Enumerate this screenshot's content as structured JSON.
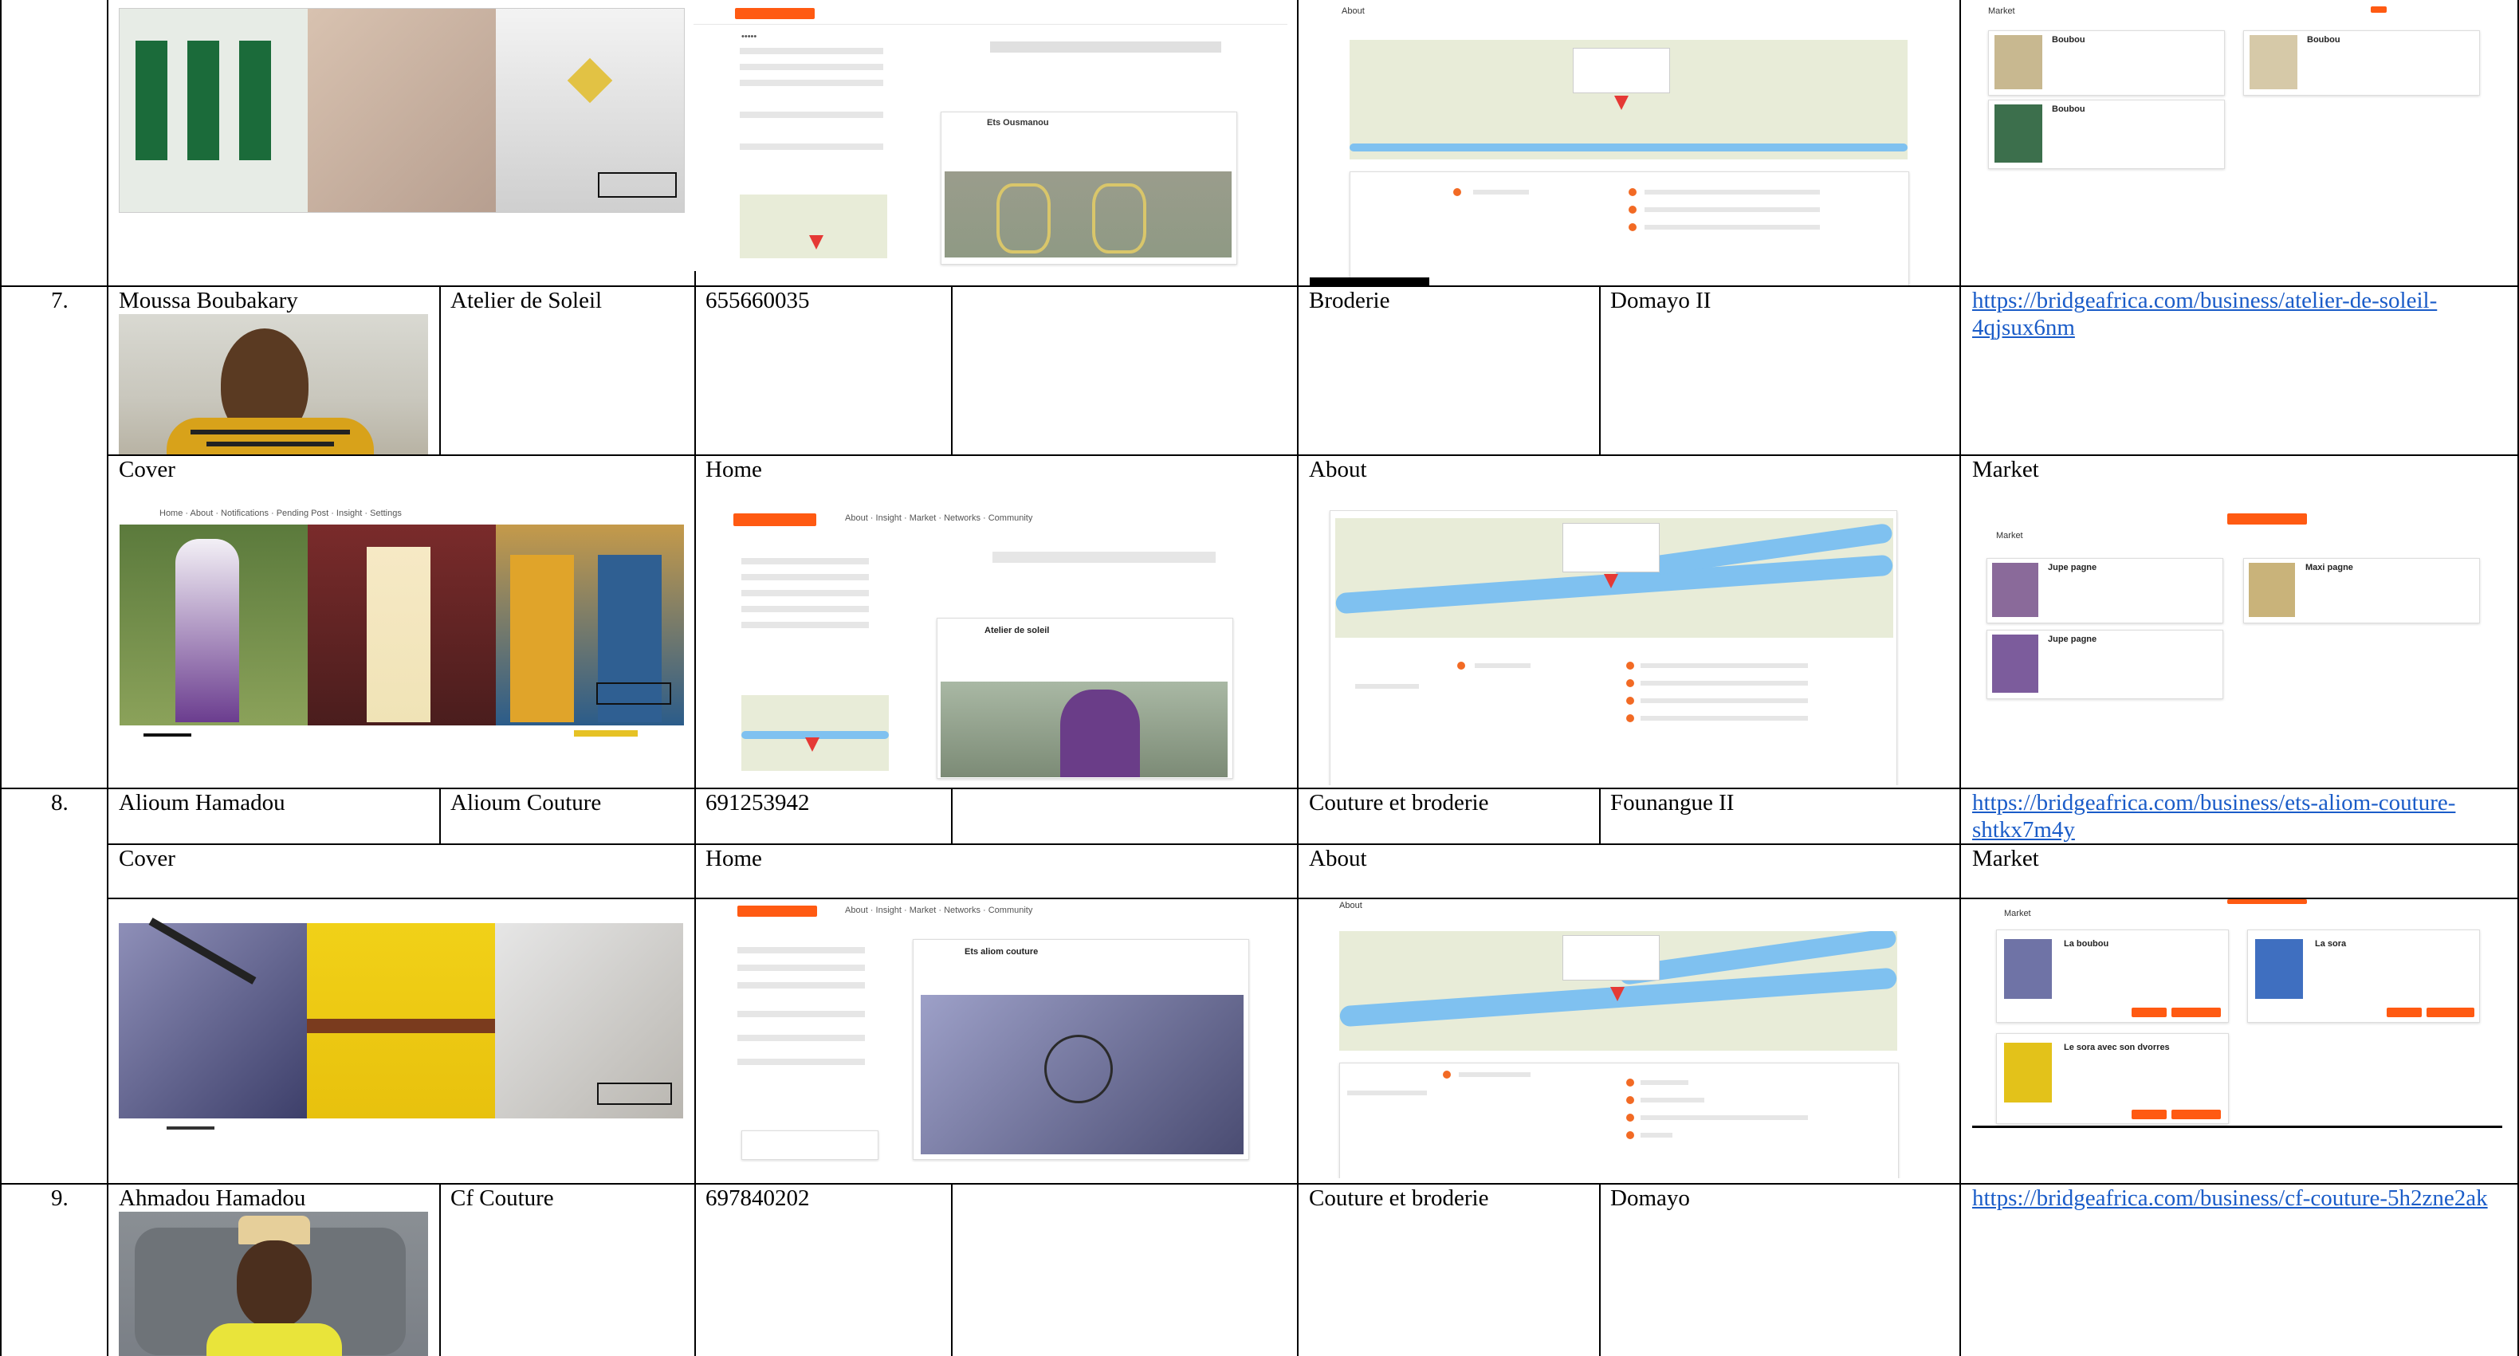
{
  "rows": [
    {
      "number": "7.",
      "name": "Moussa Boubakary",
      "business": "Atelier de Soleil",
      "phone": "655660035",
      "activity": "Broderie",
      "location": "Domayo II",
      "url": "https://bridgeafrica.com/business/atelier-de-soleil-4qjsux6nm"
    },
    {
      "number": "8.",
      "name": "Alioum Hamadou",
      "business": "Alioum Couture",
      "phone": "691253942",
      "activity": "Couture et broderie",
      "location": "Founangue II",
      "url": "https://bridgeafrica.com/business/ets-aliom-couture-shtkx7m4y"
    },
    {
      "number": "9.",
      "name": "Ahmadou Hamadou",
      "business": "Cf Couture",
      "phone": "697840202",
      "activity": "Couture et broderie",
      "location": "Domayo",
      "url": "https://bridgeafrica.com/business/cf-couture-5h2zne2ak"
    }
  ],
  "section_labels": {
    "cover": "Cover",
    "home": "Home",
    "about": "About",
    "market": "Market"
  },
  "screens": {
    "row6_home_business": "Ets Ousmanou",
    "row7_home_business": "Atelier de soleil",
    "row8_home_business": "Ets aliom couture",
    "row6_market_items": [
      "Boubou",
      "Boubou",
      "Boubou"
    ],
    "row7_market_items": [
      "Jupe pagne",
      "Jupe pagne",
      "Maxi pagne"
    ],
    "row8_market_items": [
      "La boubou",
      "La sora",
      "Le sora avec son dvorres"
    ],
    "about_title": "About",
    "market_title": "Market"
  },
  "colors": {
    "accent": "#ff5a12",
    "link": "#1a5cc8",
    "grid": "#000000"
  }
}
